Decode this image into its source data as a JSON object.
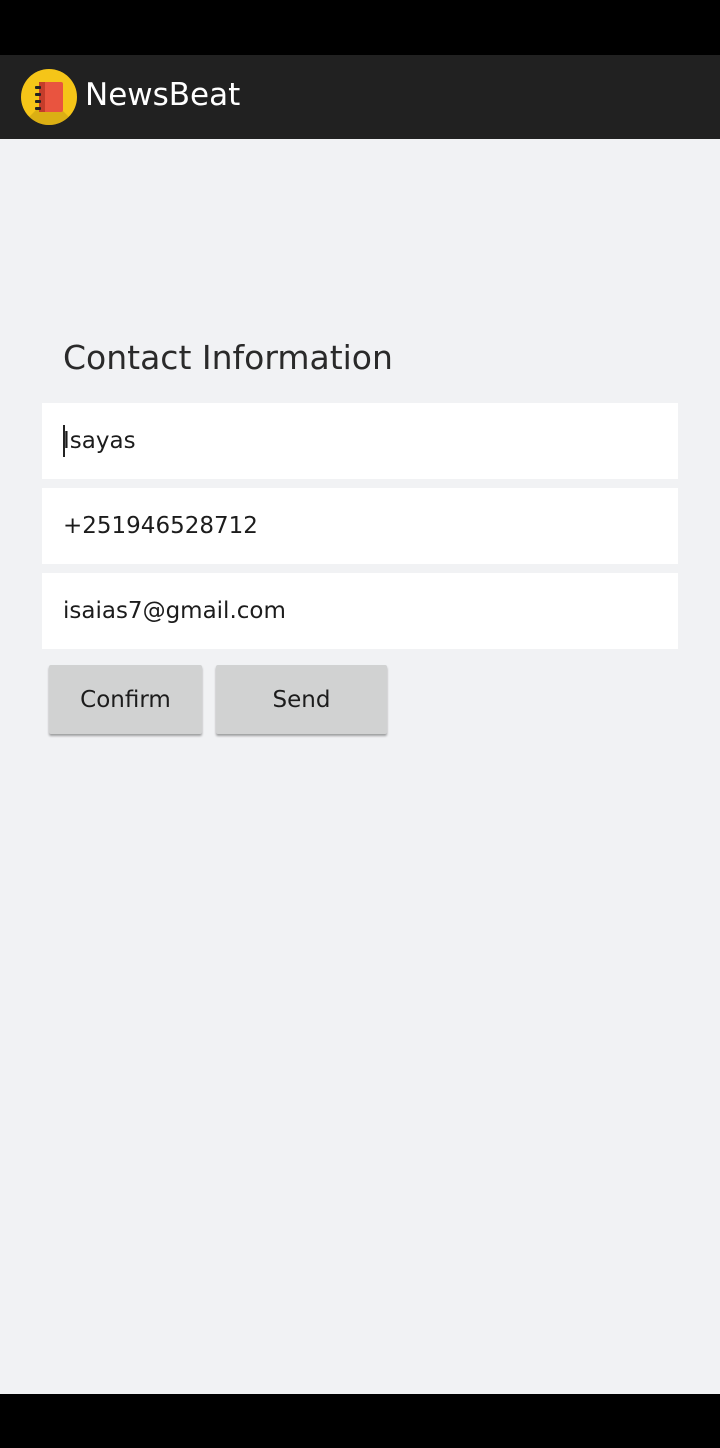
{
  "app": {
    "title": "NewsBeat",
    "logo_icon": "notebook-icon",
    "colors": {
      "app_bar": "#212121",
      "background": "#f1f2f4",
      "logo": "#f5c518",
      "button": "#d1d2d2"
    }
  },
  "contact": {
    "heading": "Contact Information",
    "name_value": "Isayas",
    "phone_value": "+251946528712",
    "email_value": "isaias7@gmail.com"
  },
  "actions": {
    "confirm_label": "Confirm",
    "send_label": "Send"
  }
}
